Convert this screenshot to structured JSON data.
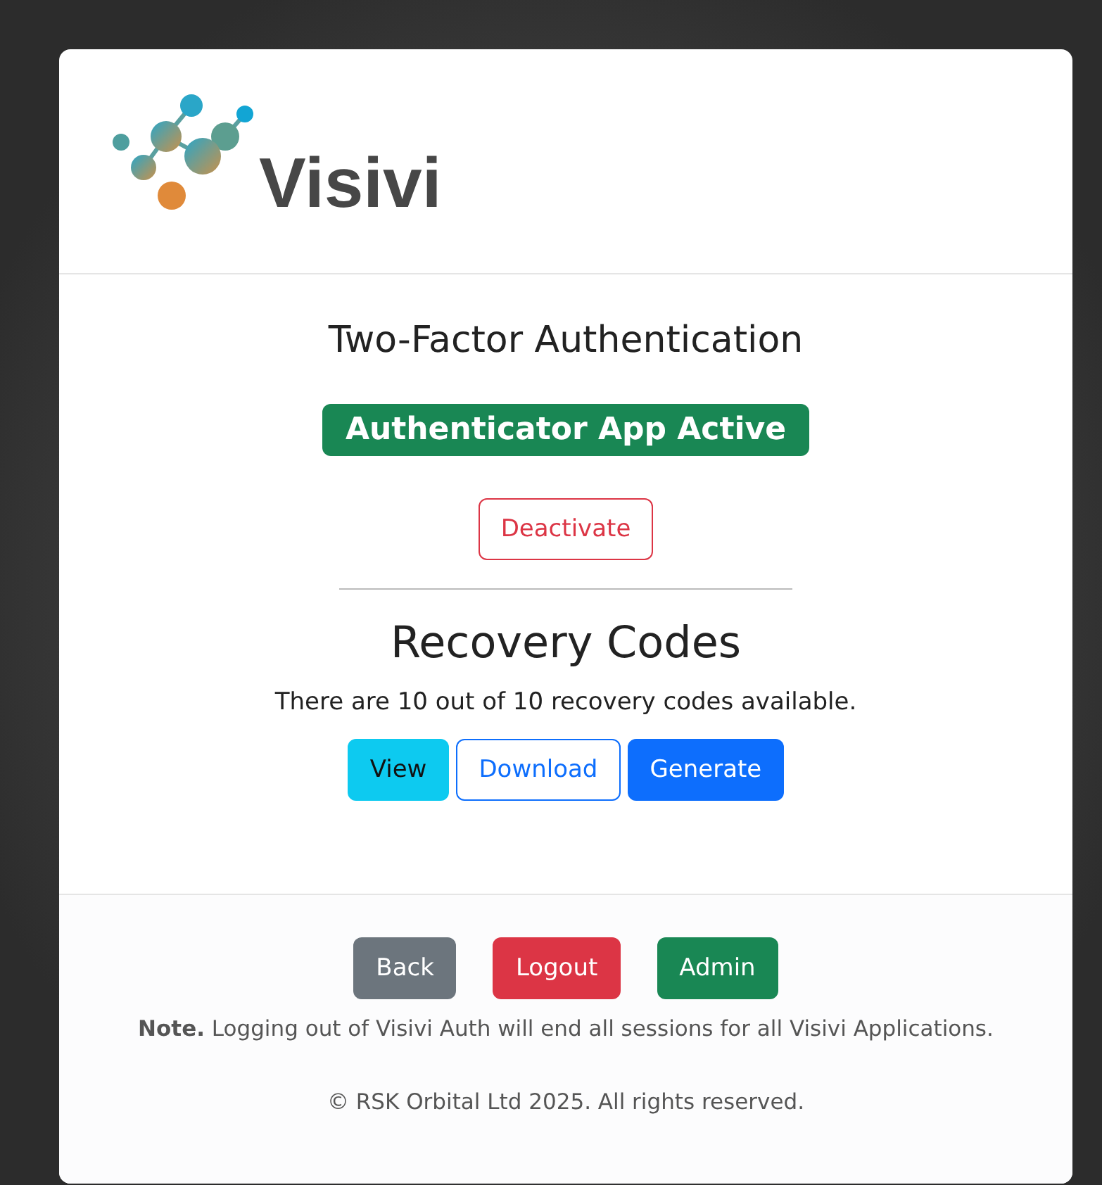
{
  "logo": {
    "text": "Visivi"
  },
  "title": "Two-Factor Authentication",
  "status_badge": "Authenticator App Active",
  "deactivate_button": {
    "label": "Deactivate",
    "kind": "outline-danger"
  },
  "recovery": {
    "heading": "Recovery Codes",
    "message": "There are 10 out of 10 recovery codes available.",
    "buttons": [
      {
        "label": "View",
        "kind": "info"
      },
      {
        "label": "Download",
        "kind": "outline-primary"
      },
      {
        "label": "Generate",
        "kind": "primary"
      }
    ]
  },
  "footer": {
    "buttons": [
      {
        "label": "Back",
        "kind": "secondary"
      },
      {
        "label": "Logout",
        "kind": "danger"
      },
      {
        "label": "Admin",
        "kind": "success"
      }
    ],
    "note": "**Note.** Logging out of Visivi Auth will end all sessions for all Visivi Applications.",
    "copyright": "© RSK Orbital Ltd 2025. All rights reserved."
  }
}
